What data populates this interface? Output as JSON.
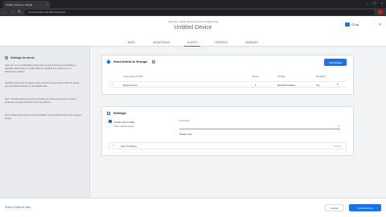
{
  "browser": {
    "tab_title": "Create a Device | Cloudy",
    "tab_close": "×",
    "window_controls": [
      "–",
      "▢",
      "×"
    ],
    "nav": {
      "back": "←",
      "forward": "→",
      "reload": "↻"
    },
    "url": "cloud.example.com/devices/create"
  },
  "header": {
    "breadcrumb": "CREATE A NEW DEVICE FROM A TEMPLATE",
    "title": "Untitled Device",
    "chat_label": "Chat",
    "close": "×"
  },
  "tabs": [
    {
      "label": "BASIC",
      "active": false
    },
    {
      "label": "MONITORING",
      "active": false
    },
    {
      "label": "ALERTS",
      "active": true
    },
    {
      "label": "REPORTS",
      "active": false
    },
    {
      "label": "SUMMARY",
      "active": false
    }
  ],
  "sidebar": {
    "title": "Settings for alerts",
    "paragraphs": [
      "Alerts are sent to all Alertable Groups when a device becomes unavailable or degraded. Each Group is notified after the specified time unless it is in a Maintenance window.",
      "Alertable Groups are the groups whose members receive Alerts when the device goes into a Disconnected or Unavailable state.",
      "Alarm Throttling limits the number of emails you receive per device in an hour, preventing message floods for recurring problems.",
      "Each enabled Alert sends an email notification to the contacts listed in the selected groups."
    ]
  },
  "alerts_card": {
    "title": "Send Alerts to Groups",
    "add_button": "Add Group",
    "columns": [
      "Group name and filter",
      "Interval",
      "Strategy",
      "Escalation"
    ],
    "rows": [
      {
        "group": "Default Group",
        "interval": "5",
        "strategy": "Default Escalation",
        "escalation": "Yes"
      }
    ]
  },
  "settings_card": {
    "title": "Settings",
    "checkbox_label": "Enable Alarms State",
    "field1_label": "Alarm Capture Level",
    "field2_label": "Time Zone",
    "field2_value": "Default Time",
    "expander": "Alarm Throttling",
    "expander_hint": "Default"
  },
  "footer": {
    "back_link": "Select a Different Task",
    "cancel": "Cancel",
    "create": "Create Device"
  },
  "colors": {
    "accent": "#1a73e8",
    "page_bg": "#f1f3f4"
  }
}
